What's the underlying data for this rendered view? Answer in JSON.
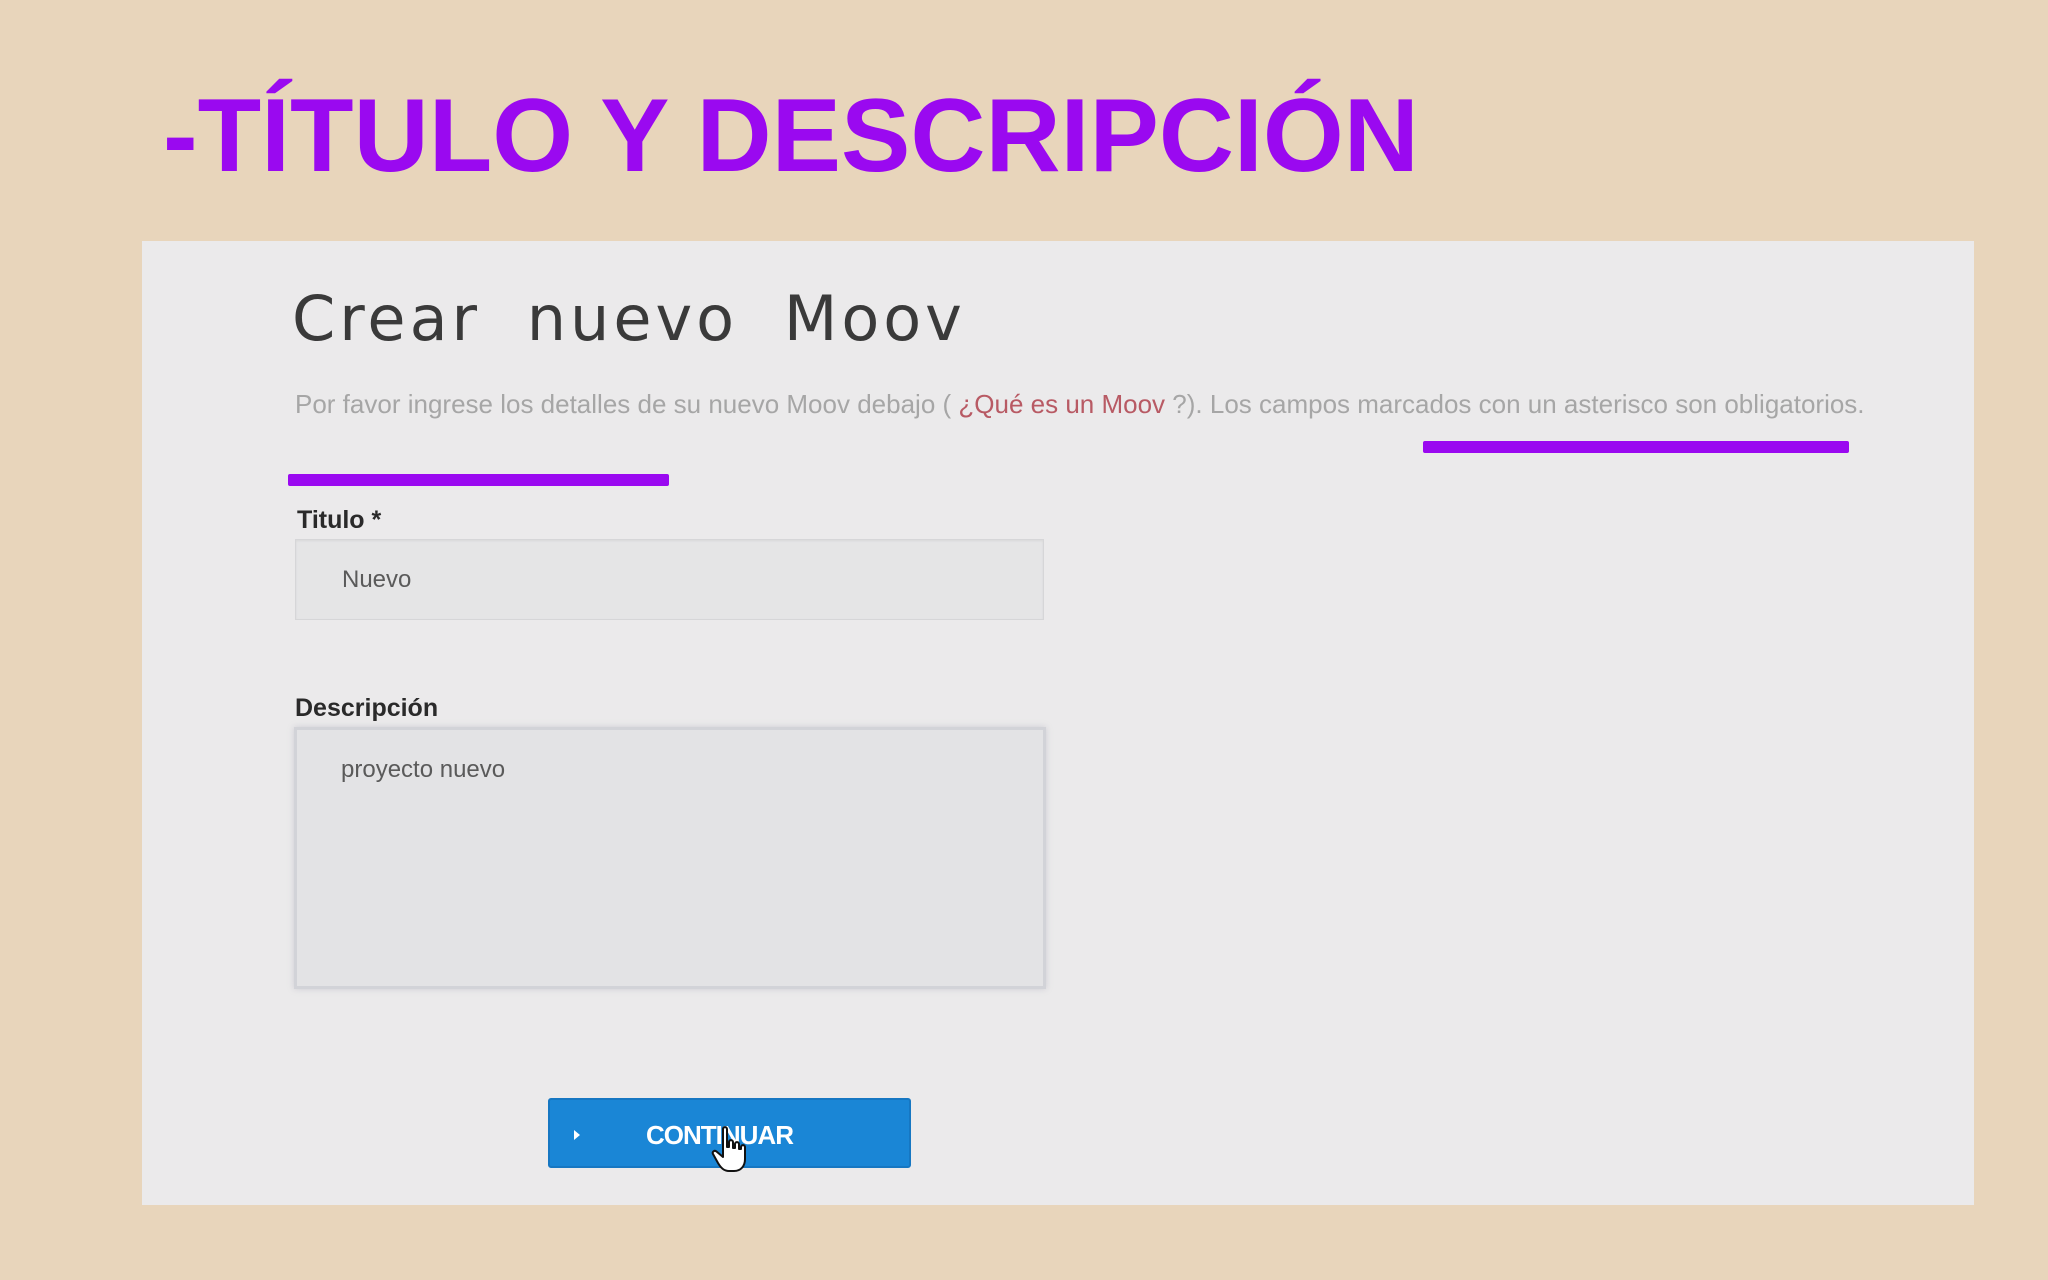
{
  "slide": {
    "title": "-TÍTULO Y DESCRIPCIÓN"
  },
  "form": {
    "heading": "Crear nuevo Moov",
    "intro_before": "Por favor ingrese los detalles de su nuevo Moov debajo (",
    "intro_link": "¿Qué es un Moov",
    "intro_after": "?). Los campos marcados con un asterisco son obligatorios.",
    "title_label": "Titulo *",
    "title_value": "Nuevo",
    "description_label": "Descripción",
    "description_value": "proyecto nuevo",
    "continue_label": "CONTINUAR"
  },
  "colors": {
    "slide_background": "#e8d5bb",
    "accent_purple": "#9a09f0",
    "button_blue": "#1a86d6",
    "link_red": "#b85a64"
  },
  "icons": {
    "button_arrow": "play-arrow-icon",
    "pointer": "hand-pointer-icon"
  }
}
